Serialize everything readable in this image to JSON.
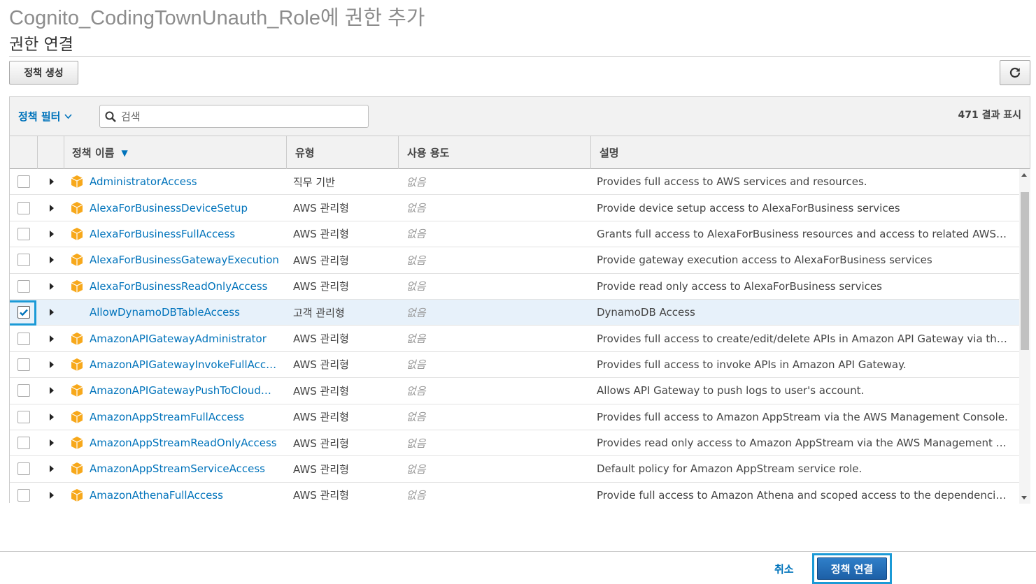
{
  "header": {
    "page_title": "Cognito_CodingTownUnauth_Role에 권한 추가",
    "section_title": "권한 연결"
  },
  "toolbar": {
    "create_policy_label": "정책 생성",
    "refresh_icon": "refresh-icon"
  },
  "filter": {
    "toggle_label": "정책 필터",
    "search_placeholder": "검색",
    "result_count": "471 결과 표시"
  },
  "table": {
    "columns": {
      "name": "정책 이름",
      "type": "유형",
      "usage": "사용 용도",
      "description": "설명"
    },
    "rows": [
      {
        "name": "AdministratorAccess",
        "type": "직무 기반",
        "usage": "없음",
        "description": "Provides full access to AWS services and resources.",
        "checked": false,
        "aws_managed": true
      },
      {
        "name": "AlexaForBusinessDeviceSetup",
        "type": "AWS 관리형",
        "usage": "없음",
        "description": "Provide device setup access to AlexaForBusiness services",
        "checked": false,
        "aws_managed": true
      },
      {
        "name": "AlexaForBusinessFullAccess",
        "type": "AWS 관리형",
        "usage": "없음",
        "description": "Grants full access to AlexaForBusiness resources and access to related AWS Servi…",
        "checked": false,
        "aws_managed": true
      },
      {
        "name": "AlexaForBusinessGatewayExecution",
        "type": "AWS 관리형",
        "usage": "없음",
        "description": "Provide gateway execution access to AlexaForBusiness services",
        "checked": false,
        "aws_managed": true
      },
      {
        "name": "AlexaForBusinessReadOnlyAccess",
        "type": "AWS 관리형",
        "usage": "없음",
        "description": "Provide read only access to AlexaForBusiness services",
        "checked": false,
        "aws_managed": true
      },
      {
        "name": "AllowDynamoDBTableAccess",
        "type": "고객 관리형",
        "usage": "없음",
        "description": "DynamoDB Access",
        "checked": true,
        "aws_managed": false
      },
      {
        "name": "AmazonAPIGatewayAdministrator",
        "type": "AWS 관리형",
        "usage": "없음",
        "description": "Provides full access to create/edit/delete APIs in Amazon API Gateway via the AWS…",
        "checked": false,
        "aws_managed": true
      },
      {
        "name": "AmazonAPIGatewayInvokeFullAccess",
        "type": "AWS 관리형",
        "usage": "없음",
        "description": "Provides full access to invoke APIs in Amazon API Gateway.",
        "checked": false,
        "aws_managed": true
      },
      {
        "name": "AmazonAPIGatewayPushToCloudW…",
        "type": "AWS 관리형",
        "usage": "없음",
        "description": "Allows API Gateway to push logs to user's account.",
        "checked": false,
        "aws_managed": true
      },
      {
        "name": "AmazonAppStreamFullAccess",
        "type": "AWS 관리형",
        "usage": "없음",
        "description": "Provides full access to Amazon AppStream via the AWS Management Console.",
        "checked": false,
        "aws_managed": true
      },
      {
        "name": "AmazonAppStreamReadOnlyAccess",
        "type": "AWS 관리형",
        "usage": "없음",
        "description": "Provides read only access to Amazon AppStream via the AWS Management Console.",
        "checked": false,
        "aws_managed": true
      },
      {
        "name": "AmazonAppStreamServiceAccess",
        "type": "AWS 관리형",
        "usage": "없음",
        "description": "Default policy for Amazon AppStream service role.",
        "checked": false,
        "aws_managed": true
      },
      {
        "name": "AmazonAthenaFullAccess",
        "type": "AWS 관리형",
        "usage": "없음",
        "description": "Provide full access to Amazon Athena and scoped access to the dependencies nee…",
        "checked": false,
        "aws_managed": true
      }
    ]
  },
  "footer": {
    "cancel_label": "취소",
    "attach_label": "정책 연결"
  },
  "colors": {
    "link": "#0073bb",
    "selected_row": "#e7f1fa",
    "focus_ring": "#1b9ad6",
    "policy_icon": "#f7a81b",
    "primary_button": "#1d5fa6"
  }
}
